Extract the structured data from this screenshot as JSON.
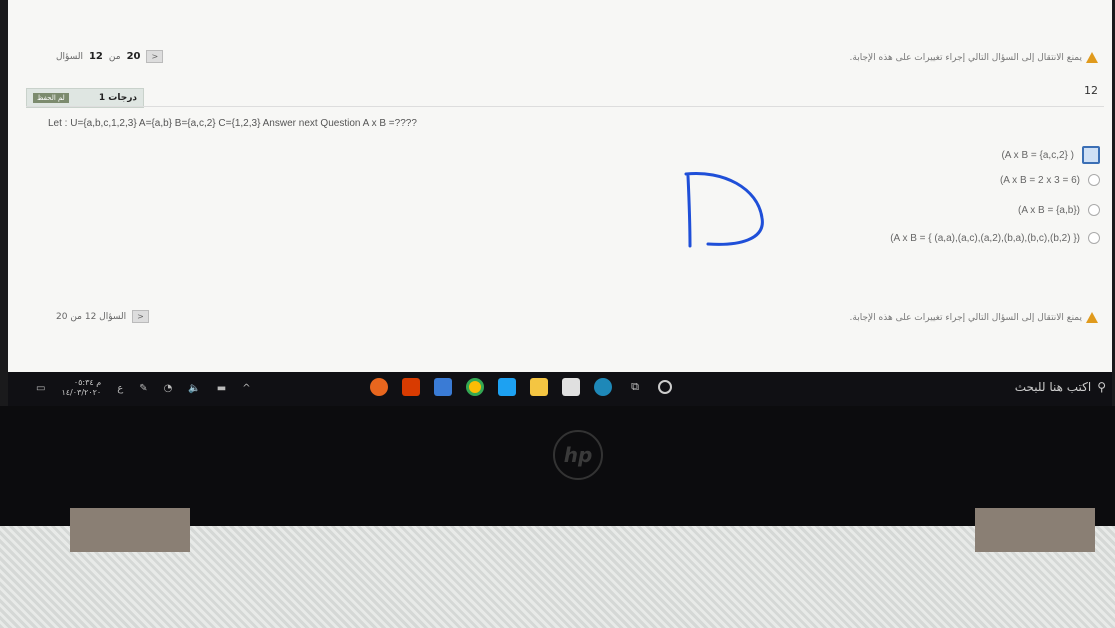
{
  "header": {
    "warning": "يمنع الانتقال إلى السؤال التالي إجراء تغييرات على هذه الإجابة.",
    "question_counter_prefix": "السؤال",
    "question_counter_current": "12",
    "question_counter_of": "من",
    "question_counter_total": "20"
  },
  "question": {
    "number": "12",
    "points": "1 درجات",
    "flag_label": "لم الحفظ",
    "text": "Let : U={a,b,c,1,2,3} A={a,b} B={a,c,2} C={1,2,3} Answer next Question A x B =????",
    "options": [
      {
        "label": "(A x B = {a,c,2} )",
        "selected": true
      },
      {
        "label": "(A x B = 2 x 3 = 6)",
        "selected": false
      },
      {
        "label": "(A x B = {a,b})",
        "selected": false
      },
      {
        "label": "(A x B = { (a,a),(a,c),(a,2),(b,a),(b,c),(b,2) })",
        "selected": false
      }
    ]
  },
  "footer": {
    "warning": "يمنع الانتقال إلى السؤال التالي إجراء تغييرات على هذه الإجابة.",
    "question_counter": "السؤال 12 من 20"
  },
  "annotation": {
    "letter": "D",
    "color": "#1f4fd8"
  },
  "taskbar": {
    "search_placeholder": "اكتب هنا للبحث",
    "time": "م ٠٥:٣٤",
    "date": "١٤/٠٣/٢٠٢٠",
    "lang": "ع",
    "icons": [
      "firefox-icon",
      "office-icon",
      "app-icon",
      "chrome-icon",
      "twitter-icon",
      "file-explorer-icon",
      "store-icon",
      "edge-icon",
      "task-view-icon",
      "cortana-icon"
    ]
  },
  "laptop": {
    "brand": "hp"
  }
}
